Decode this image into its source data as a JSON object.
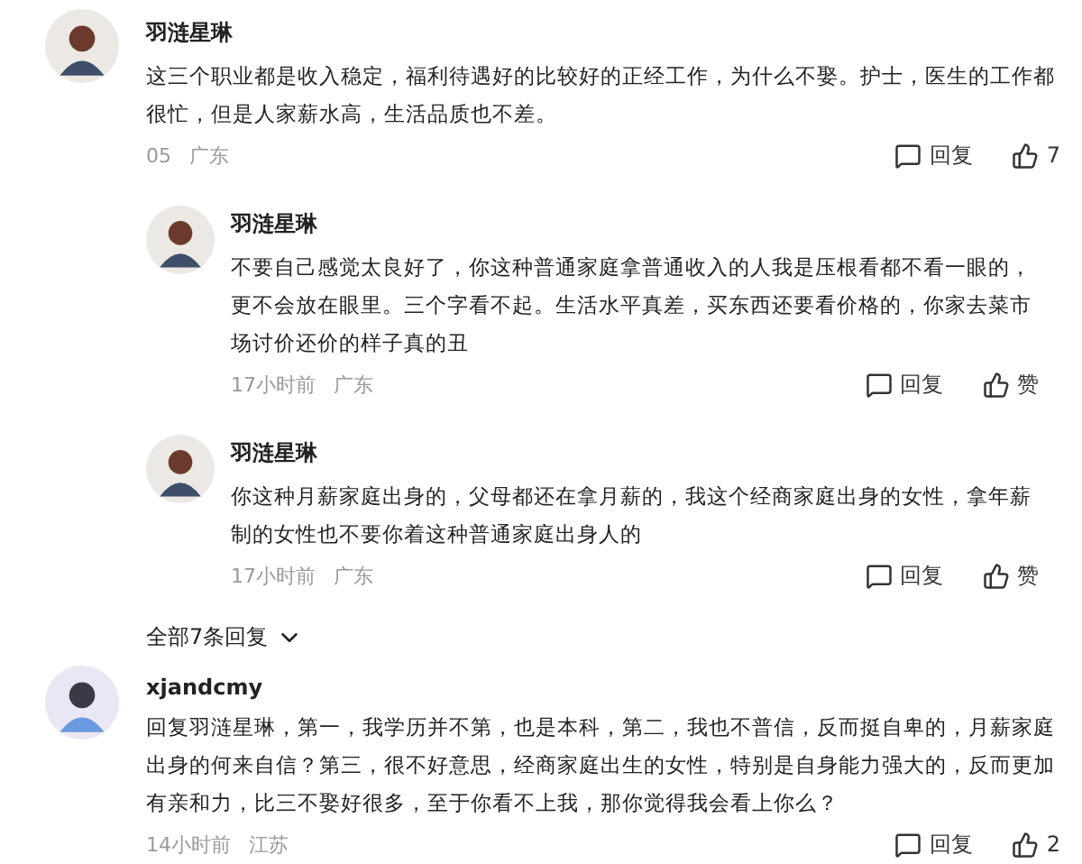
{
  "comments": [
    {
      "author": "羽涟星琳",
      "text": "这三个职业都是收入稳定，福利待遇好的比较好的正经工作，为什么不娶。护士，医生的工作都很忙，但是人家薪水高，生活品质也不差。",
      "time": "05",
      "location": "广东",
      "reply_label": "回复",
      "like_label": "7",
      "replies": [
        {
          "author": "羽涟星琳",
          "text": "不要自己感觉太良好了，你这种普通家庭拿普通收入的人我是压根看都不看一眼的，更不会放在眼里。三个字看不起。生活水平真差，买东西还要看价格的，你家去菜市场讨价还价的样子真的丑",
          "time": "17小时前",
          "location": "广东",
          "reply_label": "回复",
          "like_label": "赞"
        },
        {
          "author": "羽涟星琳",
          "text": "你这种月薪家庭出身的，父母都还在拿月薪的，我这个经商家庭出身的女性，拿年薪制的女性也不要你着这种普通家庭出身人的",
          "time": "17小时前",
          "location": "广东",
          "reply_label": "回复",
          "like_label": "赞"
        }
      ],
      "more_replies": "全部7条回复"
    },
    {
      "author": "xjandcmy",
      "text": "回复羽涟星琳，第一，我学历并不第，也是本科，第二，我也不普信，反而挺自卑的，月薪家庭出身的何来自信？第三，很不好意思，经商家庭出生的女性，特别是自身能力强大的，反而更加有亲和力，比三不娶好很多，至于你看不上我，那你觉得我会看上你么？",
      "time": "14小时前",
      "location": "江苏",
      "reply_label": "回复",
      "like_label": "2"
    }
  ]
}
